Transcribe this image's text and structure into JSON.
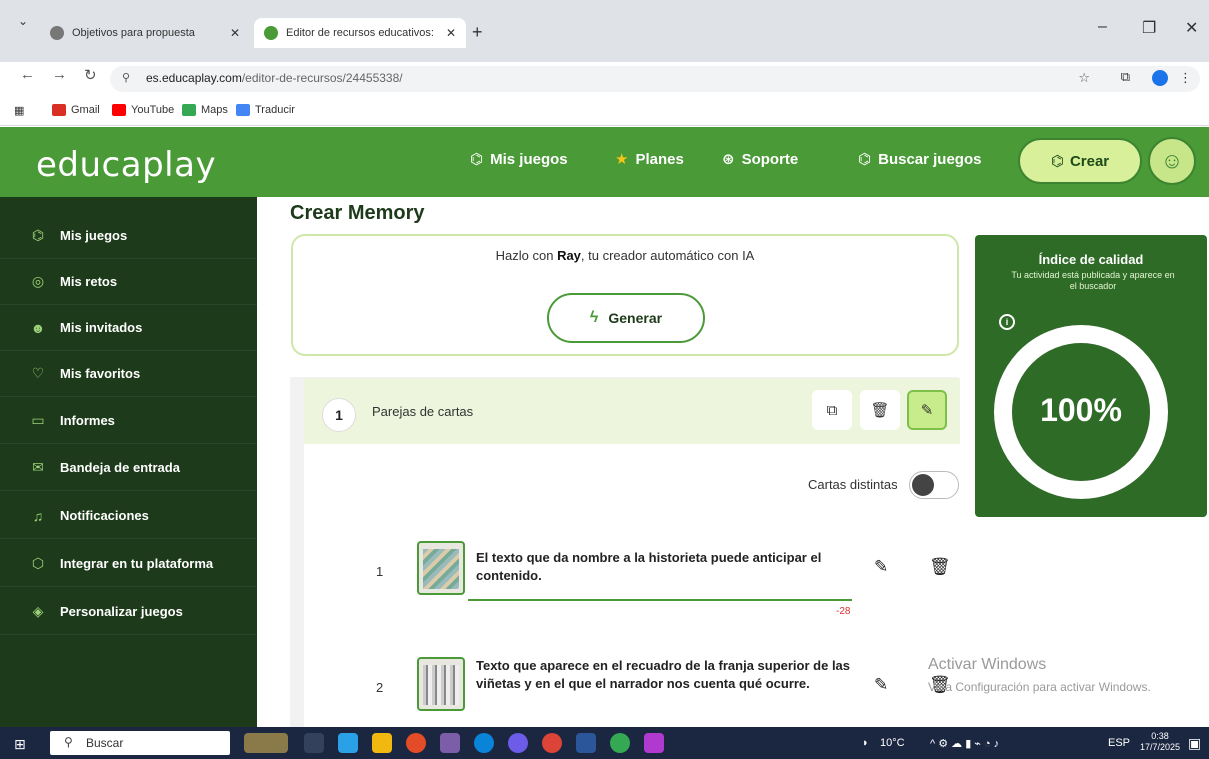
{
  "browser": {
    "tabs": [
      {
        "label": "Objetivos para propuesta"
      },
      {
        "label": "Editor de recursos educativos: E"
      }
    ],
    "new_tab": "+",
    "url_host": "es.educaplay.com",
    "url_path": "/editor-de-recursos/24455338/",
    "bookmarks": [
      "Gmail",
      "YouTube",
      "Maps",
      "Traducir"
    ]
  },
  "header": {
    "logo": "educaplay",
    "nav": [
      "Mis juegos",
      "Planes",
      "Soporte",
      "Buscar juegos"
    ],
    "create_label": "Crear"
  },
  "sidebar": {
    "items": [
      {
        "label": "Mis juegos",
        "icon": "controller-icon"
      },
      {
        "label": "Mis retos",
        "icon": "target-icon"
      },
      {
        "label": "Mis invitados",
        "icon": "users-icon"
      },
      {
        "label": "Mis favoritos",
        "icon": "heart-icon"
      },
      {
        "label": "Informes",
        "icon": "clipboard-icon"
      },
      {
        "label": "Bandeja de entrada",
        "icon": "mail-icon"
      },
      {
        "label": "Notificaciones",
        "icon": "bell-icon"
      },
      {
        "label": "Integrar en tu plataforma",
        "icon": "cube-icon"
      },
      {
        "label": "Personalizar juegos",
        "icon": "paint-icon"
      }
    ]
  },
  "main": {
    "title": "Crear Memory",
    "ray": {
      "text_before": "Hazlo con ",
      "ray_name": "Ray",
      "text_after": ", tu creador automático con IA",
      "button": "Generar"
    },
    "section": {
      "number": "1",
      "title": "Parejas de cartas",
      "toggle_label": "Cartas distintas",
      "toggle_on": false
    },
    "rows": [
      {
        "num": "1",
        "text": "El texto que da nombre a la historieta puede anticipar el contenido.",
        "counter": "-28"
      },
      {
        "num": "2",
        "text": "Texto que aparece en el recuadro de la franja superior de las viñetas y en el que el narrador nos cuenta qué ocurre."
      }
    ]
  },
  "quality": {
    "title": "Índice de calidad",
    "subtitle": "Tu actividad está publicada y aparece en el buscador",
    "percent": "100%",
    "value": 1.0
  },
  "watermark": {
    "line1": "Activar Windows",
    "line2": "Ve a Configuración para activar Windows."
  },
  "taskbar": {
    "search": "Buscar",
    "weather": "10°C",
    "lang": "ESP",
    "time": "0:38",
    "date": "17/7/2025"
  },
  "colors": {
    "brand_green": "#4a9a37",
    "sidebar_dark": "#1d3a1a",
    "quality_bg": "#2e6b26",
    "accent_light": "#d9f09b"
  }
}
